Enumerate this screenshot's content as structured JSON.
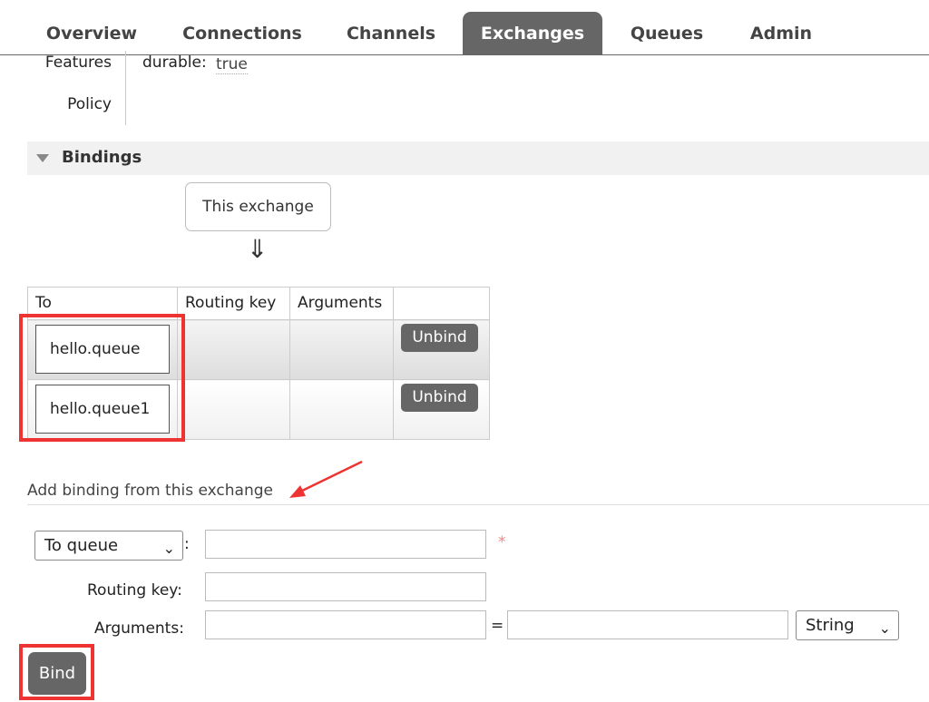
{
  "nav": {
    "tabs": [
      {
        "label": "Overview"
      },
      {
        "label": "Connections"
      },
      {
        "label": "Channels"
      },
      {
        "label": "Exchanges"
      },
      {
        "label": "Queues"
      },
      {
        "label": "Admin"
      }
    ],
    "active": "Exchanges"
  },
  "details": {
    "features_label": "Features",
    "policy_label": "Policy",
    "feature_key": "durable:",
    "feature_value": "true"
  },
  "bindings": {
    "section_title": "Bindings",
    "source_label": "This exchange",
    "arrow": "⇓",
    "columns": [
      "To",
      "Routing key",
      "Arguments",
      ""
    ],
    "rows": [
      {
        "to": "hello.queue",
        "routing_key": "",
        "arguments": "",
        "action": "Unbind"
      },
      {
        "to": "hello.queue1",
        "routing_key": "",
        "arguments": "",
        "action": "Unbind"
      }
    ]
  },
  "add_binding": {
    "title": "Add binding from this exchange",
    "destination_type": "To queue",
    "destination_colon": ":",
    "destination_value": "",
    "required_mark": "*",
    "routing_key_label": "Routing key:",
    "routing_key_value": "",
    "arguments_label": "Arguments:",
    "argument_key": "",
    "equals": "=",
    "argument_value": "",
    "argument_type": "String",
    "submit_label": "Bind"
  },
  "colors": {
    "tab_active_bg": "#666666",
    "highlight": "#ee3333",
    "button_bg": "#666666"
  }
}
